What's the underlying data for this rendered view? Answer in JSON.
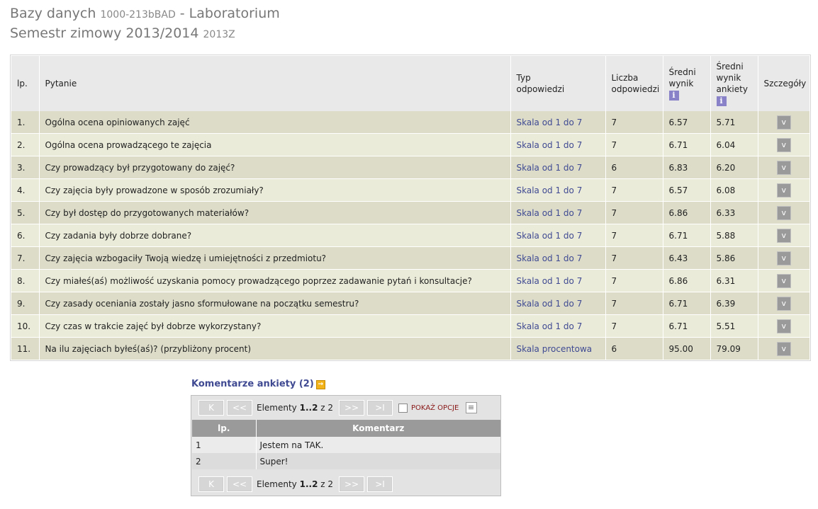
{
  "header": {
    "course_name": "Bazy danych",
    "course_code": "1000-213bBAD",
    "course_type": "- Laboratorium",
    "semester_name": "Semestr zimowy 2013/2014",
    "semester_code": "2013Z"
  },
  "table": {
    "headers": {
      "lp": "lp.",
      "question": "Pytanie",
      "type_l1": "Typ",
      "type_l2": "odpowiedzi",
      "count_l1": "Liczba",
      "count_l2": "odpowiedzi",
      "avg_l1": "Średni",
      "avg_l2": "wynik",
      "avg_all_l1": "Średni",
      "avg_all_l2": "wynik",
      "avg_all_l3": "ankiety",
      "details": "Szczegóły",
      "info_icon": "i"
    },
    "rows": [
      {
        "lp": "1.",
        "question": "Ogólna ocena opiniowanych zajęć",
        "type": "Skala od 1 do 7",
        "count": "7",
        "avg": "6.57",
        "avg_all": "5.71"
      },
      {
        "lp": "2.",
        "question": "Ogólna ocena prowadzącego te zajęcia",
        "type": "Skala od 1 do 7",
        "count": "7",
        "avg": "6.71",
        "avg_all": "6.04"
      },
      {
        "lp": "3.",
        "question": "Czy prowadzący był przygotowany do zajęć?",
        "type": "Skala od 1 do 7",
        "count": "6",
        "avg": "6.83",
        "avg_all": "6.20"
      },
      {
        "lp": "4.",
        "question": "Czy zajęcia były prowadzone w sposób zrozumiały?",
        "type": "Skala od 1 do 7",
        "count": "7",
        "avg": "6.57",
        "avg_all": "6.08"
      },
      {
        "lp": "5.",
        "question": "Czy był dostęp do przygotowanych materiałów?",
        "type": "Skala od 1 do 7",
        "count": "7",
        "avg": "6.86",
        "avg_all": "6.33"
      },
      {
        "lp": "6.",
        "question": "Czy zadania były dobrze dobrane?",
        "type": "Skala od 1 do 7",
        "count": "7",
        "avg": "6.71",
        "avg_all": "5.88"
      },
      {
        "lp": "7.",
        "question": "Czy zajęcia wzbogaciły Twoją wiedzę i umiejętności z przedmiotu?",
        "type": "Skala od 1 do 7",
        "count": "7",
        "avg": "6.43",
        "avg_all": "5.86"
      },
      {
        "lp": "8.",
        "question": "Czy miałeś(aś) możliwość uzyskania pomocy prowadzącego poprzez zadawanie pytań i konsultacje?",
        "type": "Skala od 1 do 7",
        "count": "7",
        "avg": "6.86",
        "avg_all": "6.31"
      },
      {
        "lp": "9.",
        "question": "Czy zasady oceniania zostały jasno sformułowane na początku semestru?",
        "type": "Skala od 1 do 7",
        "count": "7",
        "avg": "6.71",
        "avg_all": "6.39"
      },
      {
        "lp": "10.",
        "question": "Czy czas w trakcie zajęć był dobrze wykorzystany?",
        "type": "Skala od 1 do 7",
        "count": "7",
        "avg": "6.71",
        "avg_all": "5.51"
      },
      {
        "lp": "11.",
        "question": "Na ilu zajęciach byłeś(aś)? (przybliżony procent)",
        "type": "Skala procentowa",
        "count": "6",
        "avg": "95.00",
        "avg_all": "79.09"
      }
    ],
    "details_glyph": "v"
  },
  "comments": {
    "title": "Komentarze ankiety (2)",
    "expand_glyph": "→",
    "pager": {
      "first": "K",
      "prev": "<<",
      "next": ">>",
      "last": ">I",
      "prefix": "Elementy",
      "range": "1..2",
      "of": "z 2",
      "options_label": "POKAŻ OPCJE"
    },
    "headers": {
      "lp": "lp.",
      "comment": "Komentarz"
    },
    "rows": [
      {
        "lp": "1",
        "text": "Jestem na TAK."
      },
      {
        "lp": "2",
        "text": "Super!"
      }
    ]
  }
}
